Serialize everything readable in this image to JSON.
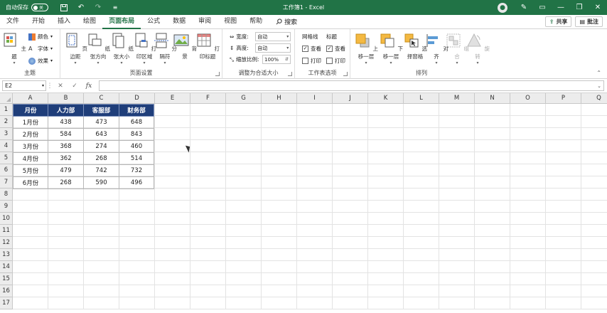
{
  "titlebar": {
    "autosave_label": "自动保存",
    "toggle_label": "关",
    "title": "工作簿1 - Excel",
    "bg_color": "#217346"
  },
  "menu": {
    "tabs": [
      "文件",
      "开始",
      "插入",
      "绘图",
      "页面布局",
      "公式",
      "数据",
      "审阅",
      "视图",
      "帮助"
    ],
    "active": "页面布局",
    "search_label": "搜索",
    "share_label": "共享",
    "comment_label": "批注"
  },
  "ribbon": {
    "theme_group": {
      "label": "主题",
      "theme_btn": "主题",
      "colors": "颜色",
      "fonts": "字体",
      "effects": "效果"
    },
    "page_setup": {
      "label": "页面设置",
      "buttons": [
        "页边距",
        "纸张方向",
        "纸张大小",
        "打印区域",
        "分隔符",
        "背景",
        "打印标题"
      ]
    },
    "scale": {
      "label": "调整为合适大小",
      "width_label": "宽度:",
      "width_value": "自动",
      "height_label": "高度:",
      "height_value": "自动",
      "scale_label": "缩放比例:",
      "scale_value": "100%"
    },
    "sheet_options": {
      "label": "工作表选项",
      "gridlines": "网格线",
      "headings": "标题",
      "view": "查看",
      "print": "打印"
    },
    "arrange": {
      "label": "排列",
      "buttons": [
        "上移一层",
        "下移一层",
        "选择窗格",
        "对齐",
        "组合",
        "旋转"
      ]
    }
  },
  "formula": {
    "namebox": "E2",
    "fx": "fx"
  },
  "grid": {
    "columns": [
      "A",
      "B",
      "C",
      "D",
      "E",
      "F",
      "G",
      "H",
      "I",
      "J",
      "K",
      "L",
      "M",
      "N",
      "O",
      "P",
      "Q"
    ],
    "rows": [
      "1",
      "2",
      "3",
      "4",
      "5",
      "6",
      "7",
      "8",
      "9",
      "10",
      "11",
      "12",
      "13",
      "14",
      "15",
      "16",
      "17"
    ],
    "header_color": "#1f3e7a",
    "table": {
      "headers": [
        "月份",
        "人力部",
        "客服部",
        "财务部"
      ],
      "rows": [
        [
          "1月份",
          "438",
          "473",
          "648"
        ],
        [
          "2月份",
          "584",
          "643",
          "843"
        ],
        [
          "3月份",
          "368",
          "274",
          "460"
        ],
        [
          "4月份",
          "362",
          "268",
          "514"
        ],
        [
          "5月份",
          "479",
          "742",
          "732"
        ],
        [
          "6月份",
          "268",
          "590",
          "496"
        ]
      ]
    }
  }
}
